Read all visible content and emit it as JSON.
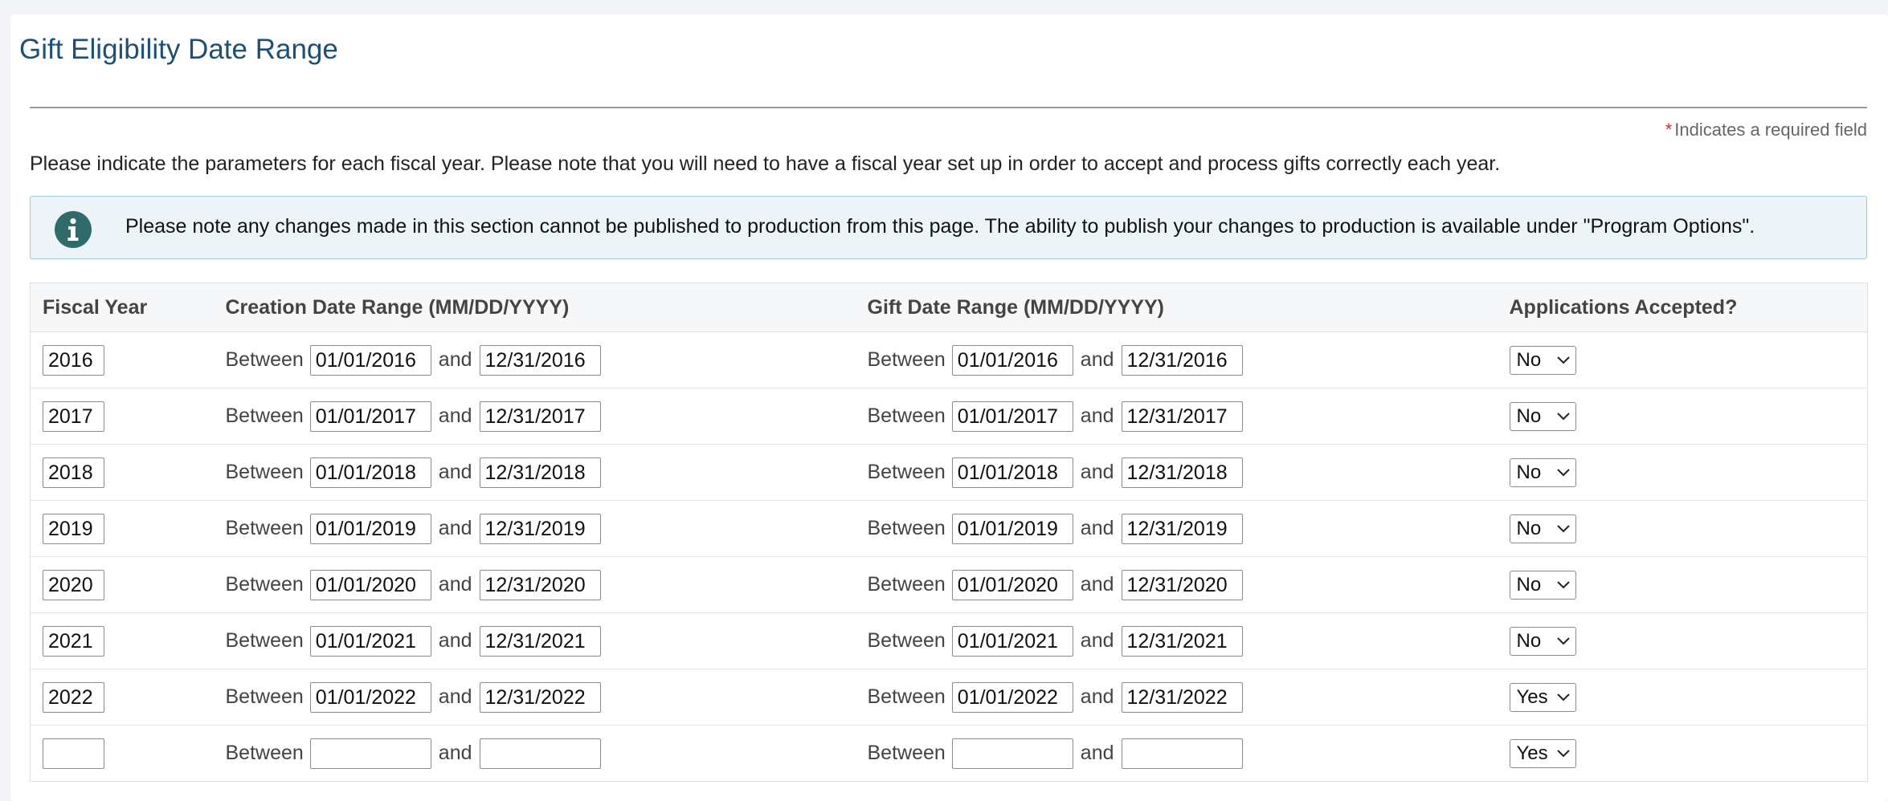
{
  "page": {
    "title": "Gift Eligibility Date Range",
    "required_asterisk": "*",
    "required_note": "Indicates a required field",
    "intro": "Please indicate the parameters for each fiscal year. Please note that you will need to have a fiscal year set up in order to accept and process gifts correctly each year.",
    "alert": {
      "icon": "info-icon",
      "text": "Please note any changes made in this section cannot be published to production from this page. The ability to publish your changes to production is available under \"Program Options\"."
    },
    "colors": {
      "title": "#1d4f78",
      "info_icon": "#2f6b6b",
      "alert_bg": "#ecf4f7",
      "alert_border": "#9fc5d6",
      "required_asterisk": "#d0312d"
    }
  },
  "table": {
    "headers": {
      "fiscal_year": "Fiscal Year",
      "creation": "Creation Date Range (MM/DD/YYYY)",
      "gift": "Gift Date Range (MM/DD/YYYY)",
      "accepted": "Applications Accepted?"
    },
    "between_label": "Between",
    "and_label": "and",
    "rows": [
      {
        "year": "2016",
        "creation_start": "01/01/2016",
        "creation_end": "12/31/2016",
        "gift_start": "01/01/2016",
        "gift_end": "12/31/2016",
        "accepted": "No"
      },
      {
        "year": "2017",
        "creation_start": "01/01/2017",
        "creation_end": "12/31/2017",
        "gift_start": "01/01/2017",
        "gift_end": "12/31/2017",
        "accepted": "No"
      },
      {
        "year": "2018",
        "creation_start": "01/01/2018",
        "creation_end": "12/31/2018",
        "gift_start": "01/01/2018",
        "gift_end": "12/31/2018",
        "accepted": "No"
      },
      {
        "year": "2019",
        "creation_start": "01/01/2019",
        "creation_end": "12/31/2019",
        "gift_start": "01/01/2019",
        "gift_end": "12/31/2019",
        "accepted": "No"
      },
      {
        "year": "2020",
        "creation_start": "01/01/2020",
        "creation_end": "12/31/2020",
        "gift_start": "01/01/2020",
        "gift_end": "12/31/2020",
        "accepted": "No"
      },
      {
        "year": "2021",
        "creation_start": "01/01/2021",
        "creation_end": "12/31/2021",
        "gift_start": "01/01/2021",
        "gift_end": "12/31/2021",
        "accepted": "No"
      },
      {
        "year": "2022",
        "creation_start": "01/01/2022",
        "creation_end": "12/31/2022",
        "gift_start": "01/01/2022",
        "gift_end": "12/31/2022",
        "accepted": "Yes"
      },
      {
        "year": "",
        "creation_start": "",
        "creation_end": "",
        "gift_start": "",
        "gift_end": "",
        "accepted": "Yes"
      }
    ]
  }
}
